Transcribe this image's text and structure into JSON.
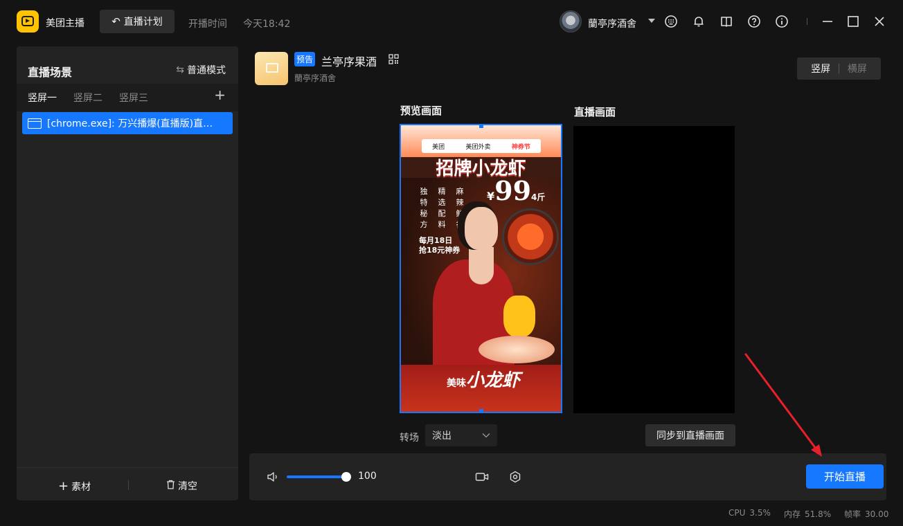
{
  "app": {
    "name": "美团主播"
  },
  "header": {
    "plan_button": "直播计划",
    "time_label": "开播时间",
    "time_value": "今天18:42",
    "user_name": "蘭亭序酒舍"
  },
  "left_panel": {
    "title": "直播场景",
    "mode_label": "普通模式",
    "tabs": [
      "竖屏一",
      "竖屏二",
      "竖屏三"
    ],
    "active_tab": 0,
    "source_item": "[chrome.exe]: 万兴播爆(直播版)直播伴侣",
    "footer_add": "素材",
    "footer_clear": "清空"
  },
  "product": {
    "badge": "预告",
    "name": "兰亭序果酒",
    "shop": "蘭亭序酒舍"
  },
  "orientation": {
    "vertical": "竖屏",
    "horizontal": "横屏",
    "selected": "竖屏"
  },
  "preview": {
    "preview_label": "预览画面",
    "live_label": "直播画面",
    "poster": {
      "brand_1": "美团",
      "brand_2": "美团外卖",
      "brand_3": "神券节",
      "title": "招牌小龙虾",
      "features": [
        [
          "独",
          "特",
          "秘",
          "方"
        ],
        [
          "精",
          "选",
          "配",
          "料"
        ],
        [
          "麻",
          "辣",
          "鲜",
          "香"
        ]
      ],
      "price_symbol": "¥",
      "price": "99",
      "price_unit": "4斤",
      "date_promo_1": "每月18日",
      "date_promo_2": "抢18元神券",
      "bottom_small": "美味",
      "bottom_big": "小龙虾"
    }
  },
  "transition": {
    "label": "转场",
    "value": "淡出"
  },
  "sync_button": "同步到直播画面",
  "controls": {
    "volume": "100",
    "start_button": "开始直播"
  },
  "status": {
    "cpu_label": "CPU",
    "cpu_value": "3.5%",
    "mem_label": "内存",
    "mem_value": "51.8%",
    "fps_label": "帧率",
    "fps_value": "30.00"
  },
  "colors": {
    "accent": "#1677ff",
    "brand_yellow": "#ffc300",
    "annotation_red": "#e8202a"
  },
  "icons": [
    "keyboard-icon",
    "bell-icon",
    "book-icon",
    "help-icon",
    "info-icon",
    "minimize-icon",
    "maximize-icon",
    "close-icon"
  ]
}
